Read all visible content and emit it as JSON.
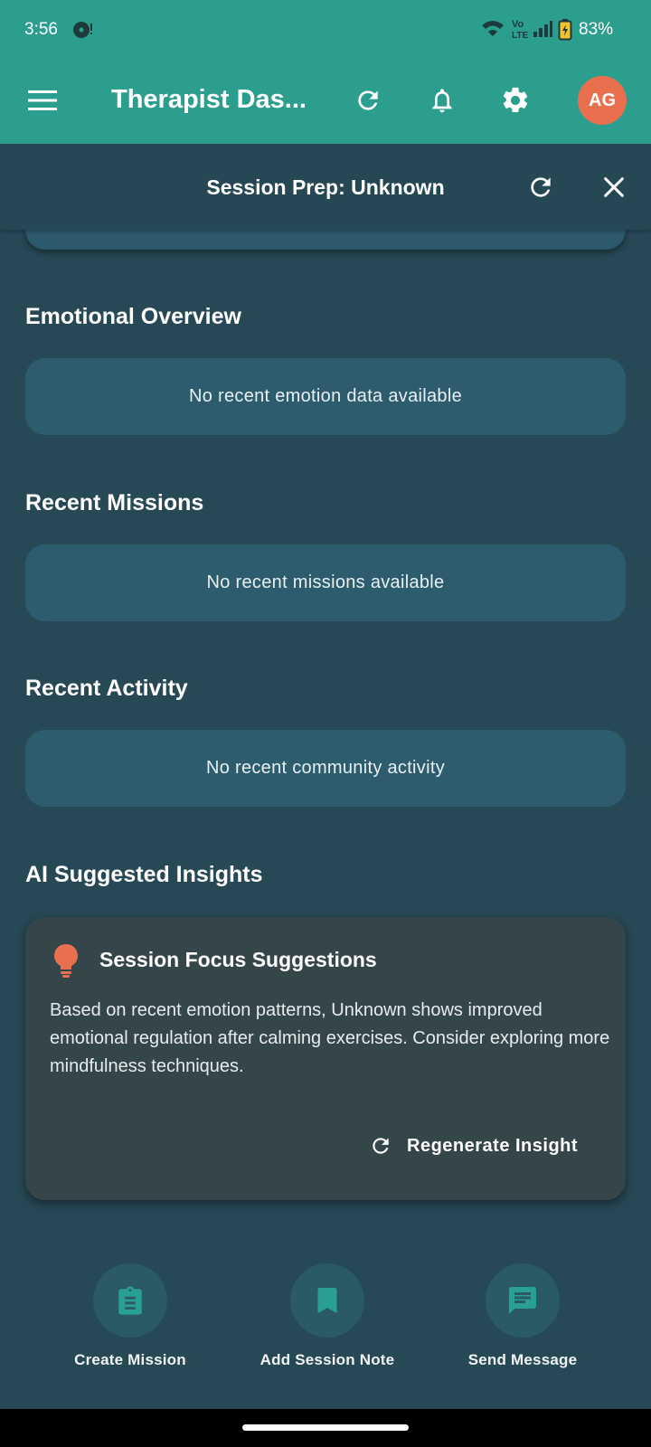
{
  "status_bar": {
    "time": "3:56",
    "battery_percent": "83%",
    "icons": [
      "media-icon",
      "wifi-icon",
      "volte-icon",
      "signal-icon",
      "battery-charging-icon"
    ]
  },
  "app_bar": {
    "title": "Therapist Das...",
    "avatar_initials": "AG",
    "icons": [
      "menu-icon",
      "refresh-icon",
      "bell-icon",
      "settings-icon"
    ]
  },
  "session_prep": {
    "title": "Session Prep: Unknown",
    "icons": [
      "refresh-icon",
      "close-icon"
    ]
  },
  "sections": {
    "emotional_overview": {
      "title": "Emotional Overview",
      "empty_text": "No recent emotion data available"
    },
    "recent_missions": {
      "title": "Recent Missions",
      "empty_text": "No recent missions available"
    },
    "recent_activity": {
      "title": "Recent Activity",
      "empty_text": "No recent community activity"
    },
    "ai_insights": {
      "title": "AI Suggested Insights"
    }
  },
  "insight_card": {
    "title": "Session Focus Suggestions",
    "body": "Based on recent emotion patterns, Unknown shows improved emotional regulation after calming exercises. Consider exploring more mindfulness techniques.",
    "regenerate_label": "Regenerate Insight",
    "icon": "lightbulb-icon"
  },
  "quick_actions": [
    {
      "label": "Create Mission",
      "icon": "clipboard-icon"
    },
    {
      "label": "Add Session Note",
      "icon": "bookmark-icon"
    },
    {
      "label": "Send Message",
      "icon": "message-icon"
    }
  ],
  "colors": {
    "header": "#2b9e8e",
    "background": "#274855",
    "card": "#2c5c6e",
    "insight_card": "#35464a",
    "accent_orange": "#e8704f",
    "action_icon": "#2aa090"
  }
}
